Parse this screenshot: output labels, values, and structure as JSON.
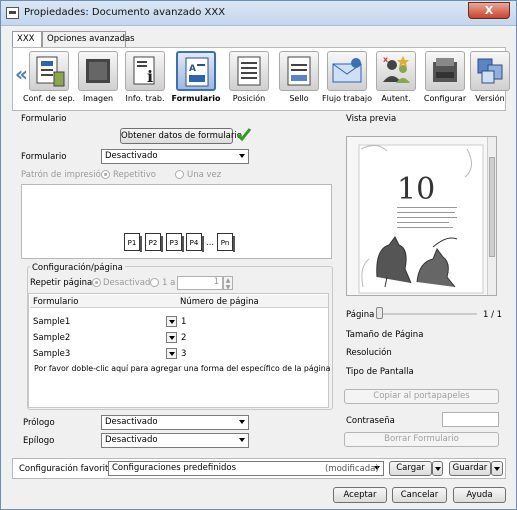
{
  "window": {
    "title": "Propiedades: Documento avanzado XXX",
    "close_label": "X"
  },
  "tabs": [
    "XXX",
    "Opciones avanzadas"
  ],
  "toolbar": {
    "items": [
      {
        "label": "Conf. de sep.",
        "icon": "separation-settings-icon"
      },
      {
        "label": "Imagen",
        "icon": "image-icon"
      },
      {
        "label": "Info. trab.",
        "icon": "job-info-icon"
      },
      {
        "label": "Formulario",
        "icon": "form-icon",
        "selected": true
      },
      {
        "label": "Posición",
        "icon": "position-icon"
      },
      {
        "label": "Sello",
        "icon": "stamp-icon"
      },
      {
        "label": "Flujo trabajo",
        "icon": "workflow-icon"
      },
      {
        "label": "Autent.",
        "icon": "authentication-icon"
      },
      {
        "label": "Configurar",
        "icon": "configure-icon"
      },
      {
        "label": "Versión",
        "icon": "version-icon"
      }
    ]
  },
  "form": {
    "section_title": "Formulario",
    "get_data_button": "Obtener datos de formulario",
    "form_label": "Formulario",
    "form_value": "Desactivado",
    "print_pattern_label": "Patrón de impresión",
    "repetitive_label": "Repetitivo",
    "once_label": "Una vez",
    "pages": [
      "P1",
      "P2",
      "P3",
      "P4",
      "...",
      "Pn"
    ]
  },
  "page_config": {
    "title": "Configuración/página",
    "repeat_label": "Repetir páginas",
    "disabled_label": "Desactivado",
    "range_label": "1 a",
    "range_value": "1",
    "table_headers": [
      "Formulario",
      "Número de página"
    ],
    "rows": [
      {
        "form": "Sample1",
        "page": "1"
      },
      {
        "form": "Sample2",
        "page": "2"
      },
      {
        "form": "Sample3",
        "page": "3"
      }
    ],
    "hint": "Por favor doble-clic aquí para agregar una forma del específico de la página"
  },
  "prologue": {
    "label": "Prólogo",
    "value": "Desactivado"
  },
  "epilogue": {
    "label": "Epílogo",
    "value": "Desactivado"
  },
  "preview": {
    "title": "Vista previa",
    "page_label": "Página",
    "page_count": "1 / 1",
    "page_size_label": "Tamaño de Página",
    "resolution_label": "Resolución",
    "screen_type_label": "Tipo de Pantalla",
    "copy_button": "Copiar al portapapeles",
    "password_label": "Contraseña",
    "delete_button": "Borrar Formulario",
    "sample_number": "10"
  },
  "favorites": {
    "label": "Configuración favorita",
    "value": "Configuraciones predefinidos",
    "modified": "(modificada)",
    "load_button": "Cargar",
    "save_button": "Guardar"
  },
  "footer": {
    "ok": "Aceptar",
    "cancel": "Cancelar",
    "help": "Ayuda"
  },
  "colors": {
    "accent": "#3b6fb8",
    "check": "#2e9d1f",
    "title_bar": "#c3d6ec"
  }
}
